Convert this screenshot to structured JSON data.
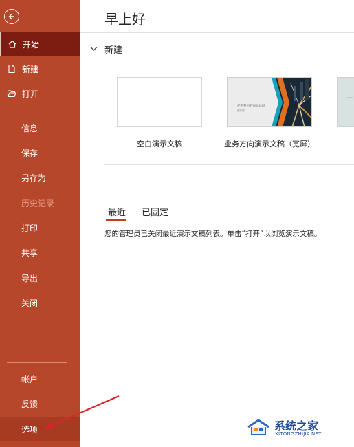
{
  "sidebar": {
    "back_icon": "back-arrow-icon",
    "primary": [
      {
        "label": "开始",
        "icon": "home-icon",
        "active": true
      },
      {
        "label": "新建",
        "icon": "new-file-icon"
      },
      {
        "label": "打开",
        "icon": "folder-open-icon"
      }
    ],
    "secondary": [
      {
        "label": "信息"
      },
      {
        "label": "保存"
      },
      {
        "label": "另存为"
      },
      {
        "label": "历史记录",
        "disabled": true
      },
      {
        "label": "打印"
      },
      {
        "label": "共享"
      },
      {
        "label": "导出"
      },
      {
        "label": "关闭"
      }
    ],
    "bottom": [
      {
        "label": "帐户"
      },
      {
        "label": "反馈"
      },
      {
        "label": "选项",
        "highlighted": true
      }
    ]
  },
  "main": {
    "greeting": "早上好",
    "new_section": {
      "title": "新建",
      "templates": [
        {
          "label": "空白演示文稿"
        },
        {
          "label": "业务方向演示文稿（宽屏）",
          "thumb_title": "使用开创的商标标题",
          "thumb_sub": "副标题"
        }
      ]
    },
    "tabs": [
      {
        "label": "最近",
        "selected": true
      },
      {
        "label": "已固定"
      }
    ],
    "recent_message": "您的管理员已关闭最近演示文稿列表。单击“打开”以浏览演示文稿。"
  },
  "watermark": {
    "title": "系统之家",
    "url": "XITONGZHIJIA.NET"
  },
  "colors": {
    "sidebar_bg": "#b7472a",
    "active_bg": "#7d1c10",
    "accent": "#c43e1c",
    "arrow": "#d7262b"
  }
}
